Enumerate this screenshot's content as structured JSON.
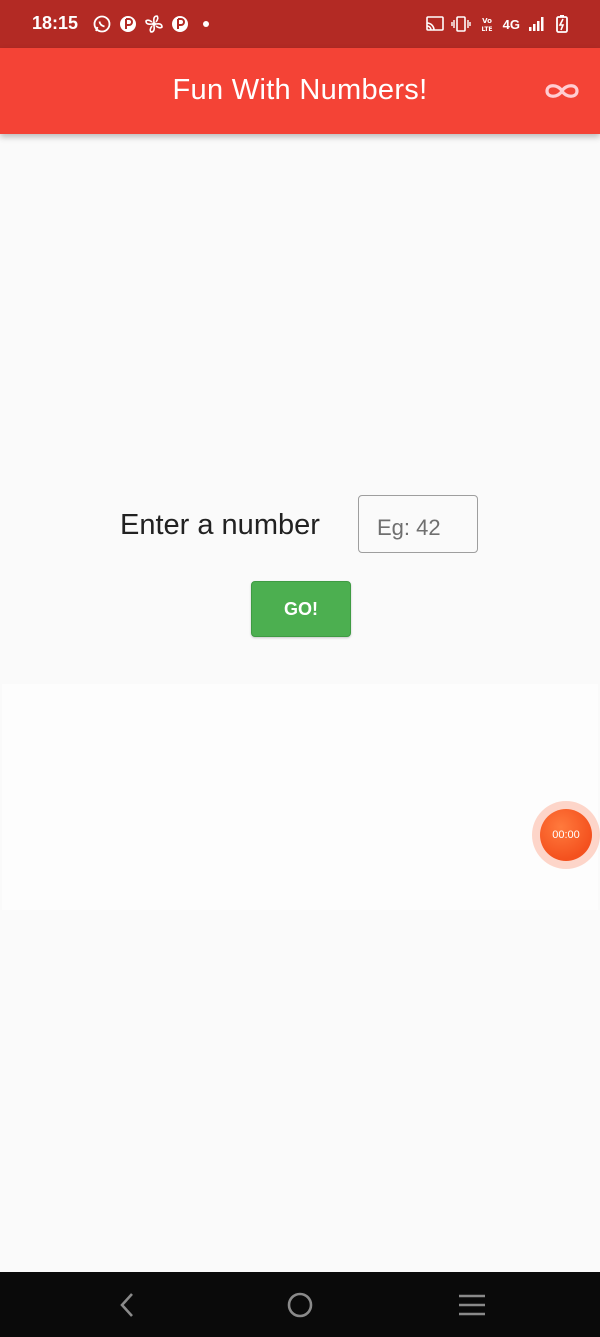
{
  "status_bar": {
    "time": "18:15",
    "network": "4G",
    "left_icons": [
      "whatsapp-icon",
      "notification-icon",
      "fan-icon",
      "notification-icon",
      "dot-icon"
    ],
    "right_icons": [
      "cast-icon",
      "vibrate-icon",
      "volte-icon",
      "signal-icon",
      "battery-charging-icon"
    ]
  },
  "app_bar": {
    "title": "Fun With Numbers!",
    "action_icon": "infinity-icon",
    "color": "#f44336"
  },
  "form": {
    "label": "Enter a number",
    "input_placeholder": "Eg: 42",
    "input_value": "",
    "go_label": "GO!",
    "go_color": "#4caf50"
  },
  "recorder": {
    "timer": "00:00",
    "color": "#f4511e"
  },
  "nav_bar": {
    "buttons": [
      "back-icon",
      "home-icon",
      "menu-icon"
    ]
  }
}
